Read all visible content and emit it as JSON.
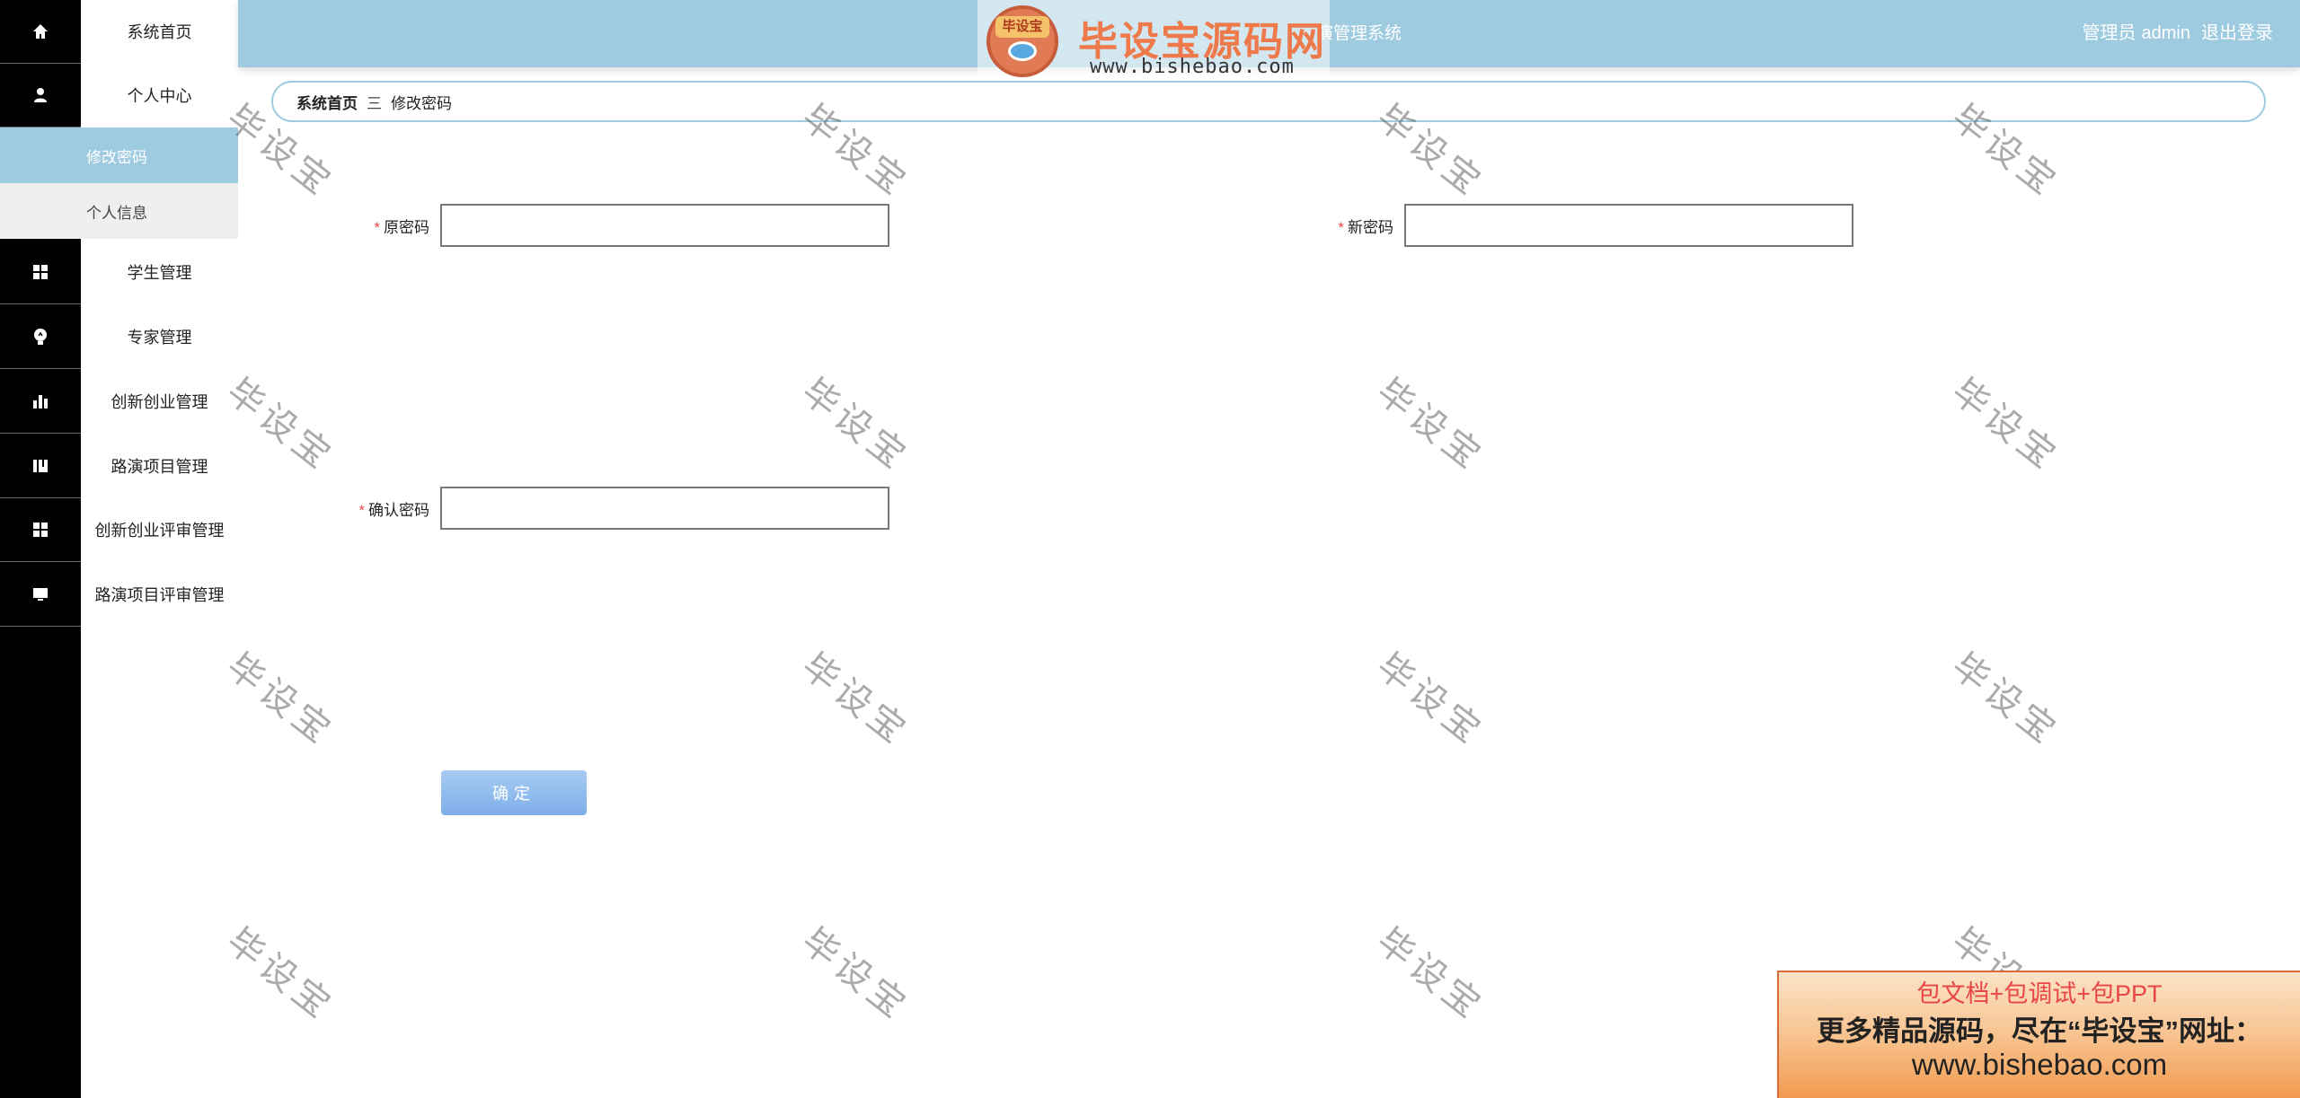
{
  "header": {
    "system_title": "演管理系统",
    "user_role": "管理员",
    "username": "admin",
    "logout_label": "退出登录",
    "bg_color": "#9ecbe0"
  },
  "logo": {
    "badge_text": "毕设宝",
    "name": "毕设宝源码网",
    "url": "www.bishebao.com"
  },
  "sidebar": {
    "items": [
      {
        "label": "系统首页",
        "icon": "home-icon"
      },
      {
        "label": "个人中心",
        "icon": "user-icon"
      },
      {
        "label": "学生管理",
        "icon": "grid-icon"
      },
      {
        "label": "专家管理",
        "icon": "bulb-icon"
      },
      {
        "label": "创新创业管理",
        "icon": "bar-chart-icon"
      },
      {
        "label": "路演项目管理",
        "icon": "book-icon"
      },
      {
        "label": "创新创业评审管理",
        "icon": "grid-icon"
      },
      {
        "label": "路演项目评审管理",
        "icon": "monitor-icon"
      }
    ],
    "sub_items": [
      {
        "label": "修改密码",
        "active": true
      },
      {
        "label": "个人信息",
        "active": false
      }
    ],
    "active_color": "#9ecbe0"
  },
  "breadcrumb": {
    "home": "系统首页",
    "separator": "三",
    "current": "修改密码"
  },
  "form": {
    "required_mark": "*",
    "old_password_label": "原密码",
    "new_password_label": "新密码",
    "confirm_password_label": "确认密码",
    "submit_label": "确定"
  },
  "watermark": {
    "text": "毕设宝"
  },
  "ad_banner": {
    "line1": "包文档+包调试+包PPT",
    "line2": "更多精品源码，尽在“毕设宝”网址：",
    "line3": "www.bishebao.com"
  }
}
